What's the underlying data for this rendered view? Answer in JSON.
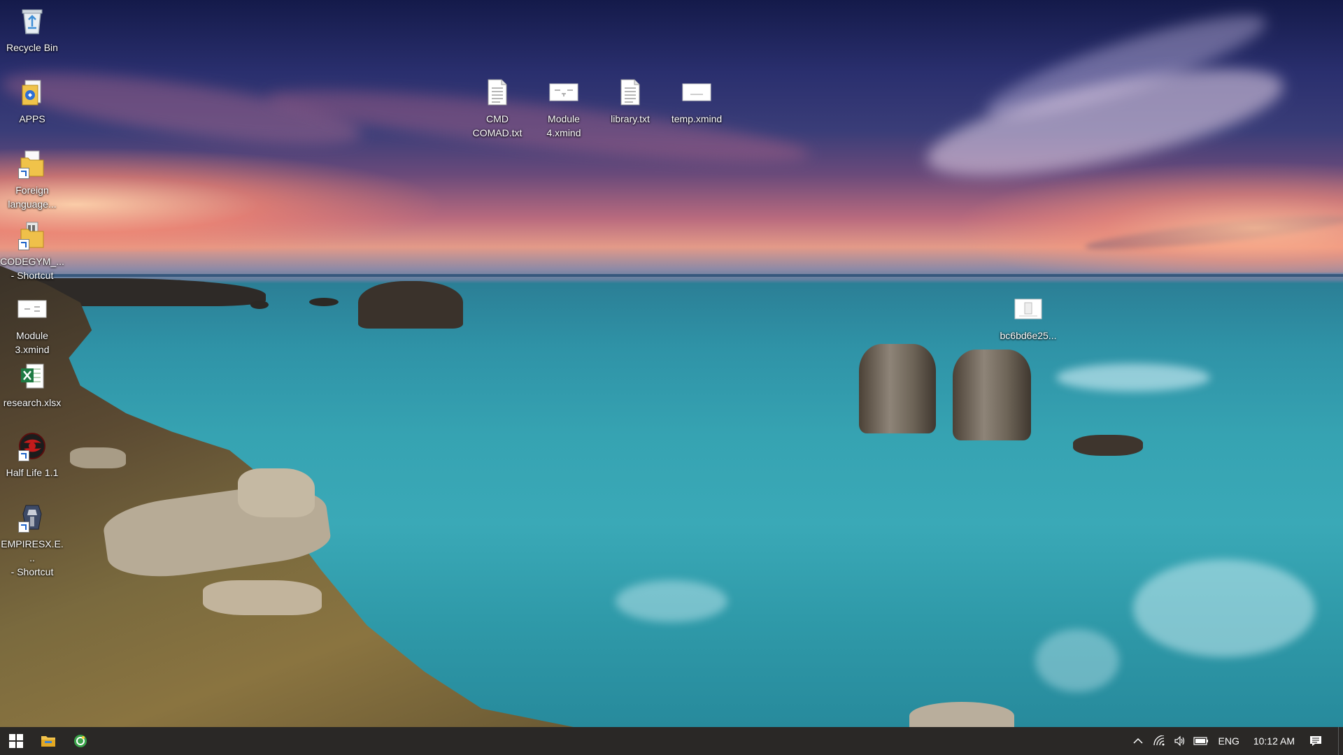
{
  "desktop": {
    "icons": [
      {
        "id": "recycle-bin",
        "label": "Recycle Bin",
        "icon": "recycle-bin-icon"
      },
      {
        "id": "apps",
        "label": "APPS",
        "icon": "apps-folder-icon"
      },
      {
        "id": "foreign-language",
        "label": "Foreign\nlanguage...",
        "icon": "folder-shortcut-icon"
      },
      {
        "id": "codegym",
        "label": "CODEGYM_...\n- Shortcut",
        "icon": "folder-shortcut-icon"
      },
      {
        "id": "module3",
        "label": "Module\n3.xmind",
        "icon": "xmind-file-icon"
      },
      {
        "id": "research",
        "label": "research.xlsx",
        "icon": "excel-file-icon"
      },
      {
        "id": "halflife",
        "label": "Half Life 1.1",
        "icon": "half-life-shortcut-icon"
      },
      {
        "id": "empires",
        "label": "EMPIRESX.E...\n- Shortcut",
        "icon": "empires-shortcut-icon"
      },
      {
        "id": "cmd-comad",
        "label": "CMD\nCOMAD.txt",
        "icon": "text-file-icon"
      },
      {
        "id": "module4",
        "label": "Module\n4.xmind",
        "icon": "xmind-file-icon"
      },
      {
        "id": "library",
        "label": "library.txt",
        "icon": "text-file-icon"
      },
      {
        "id": "temp",
        "label": "temp.xmind",
        "icon": "xmind-file-icon"
      },
      {
        "id": "bc6bd",
        "label": "bc6bd6e25...",
        "icon": "image-file-icon"
      }
    ]
  },
  "taskbar": {
    "pinned": [
      {
        "name": "start-button",
        "icon": "windows-logo-icon"
      },
      {
        "name": "file-explorer-button",
        "icon": "file-explorer-icon"
      },
      {
        "name": "app-button",
        "icon": "green-app-icon"
      }
    ],
    "tray": {
      "chevron_icon": "chevron-up-icon",
      "network_icon": "wifi-icon",
      "volume_icon": "speaker-icon",
      "battery_icon": "battery-icon",
      "language": "ENG",
      "time": "10:12 AM",
      "notifications_icon": "action-center-icon"
    }
  }
}
